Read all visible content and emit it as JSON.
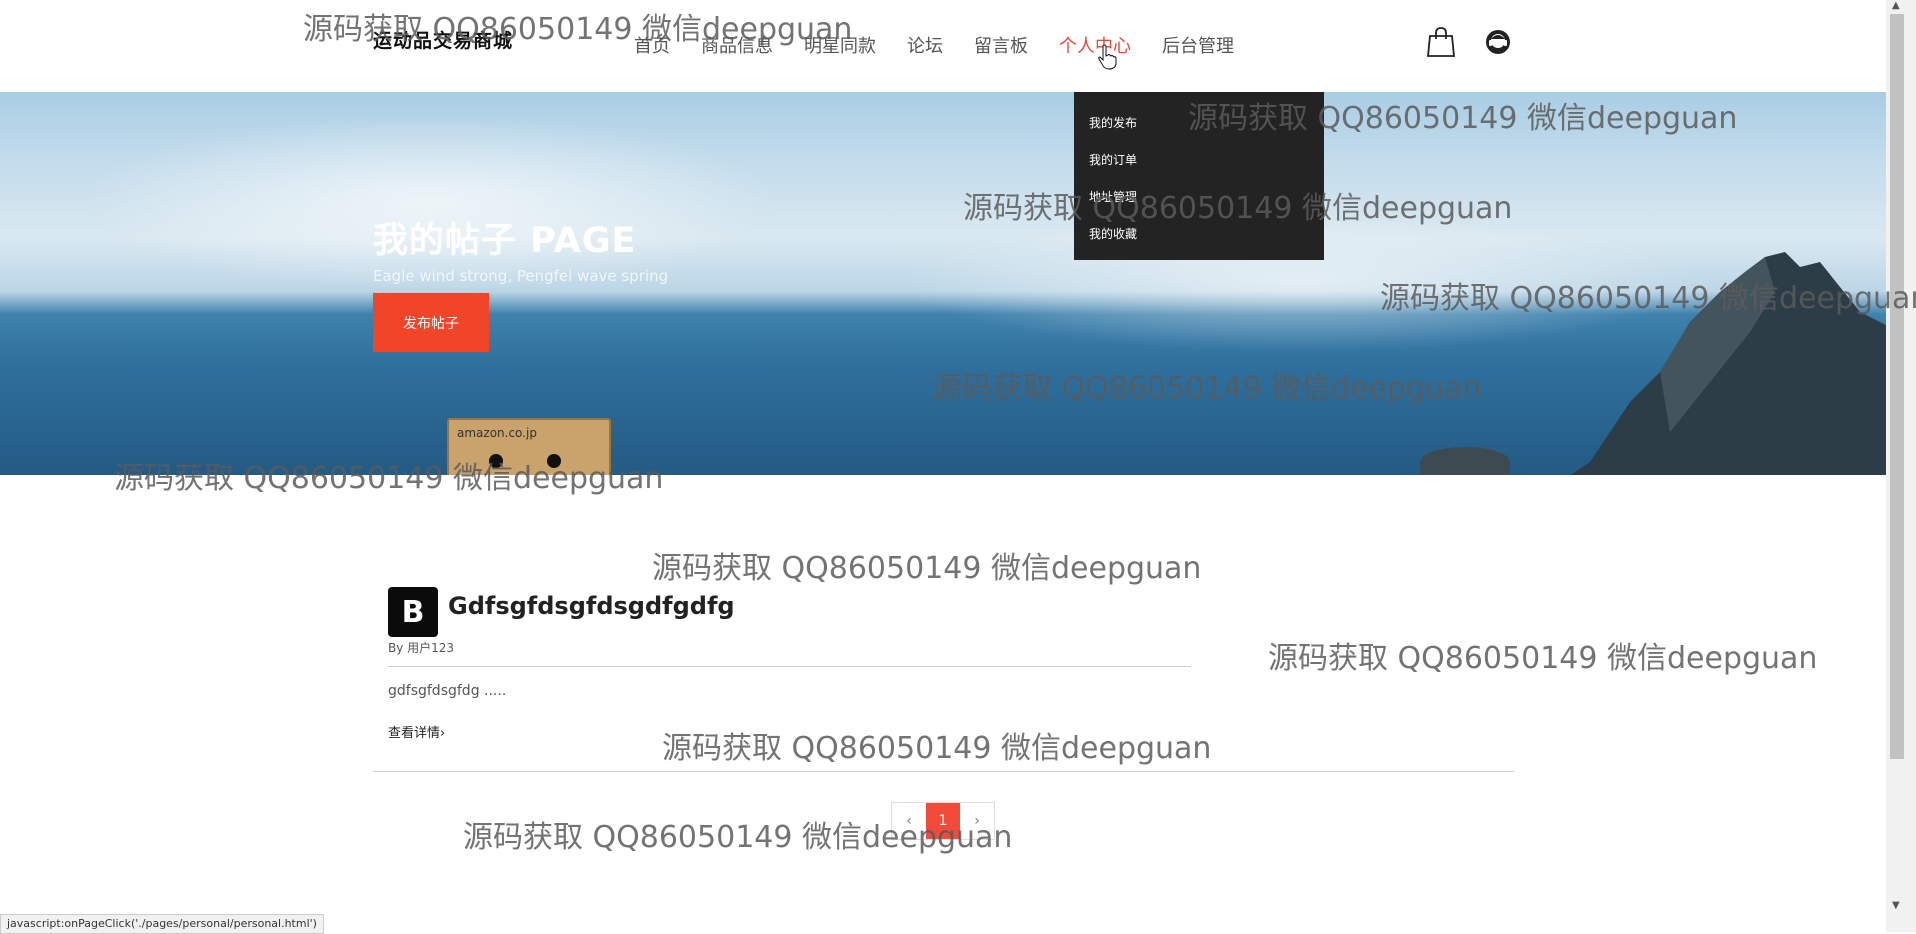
{
  "header": {
    "logo": "运动品交易商城",
    "nav": [
      "首页",
      "商品信息",
      "明星同款",
      "论坛",
      "留言板",
      "个人中心",
      "后台管理"
    ],
    "active_nav": "个人中心"
  },
  "dropdown": {
    "items": [
      "我的发布",
      "我的订单",
      "地址管理",
      "我的收藏"
    ]
  },
  "hero": {
    "title": "我的帖子 PAGE",
    "subtitle": "Eagle wind strong, Pengfei wave spring",
    "button": "发布帖子",
    "box_label": "amazon.co.jp"
  },
  "post": {
    "avatar_letter": "B",
    "title": "Gdfsgfdsgfdsgdfgdfg",
    "author": "By 用户123",
    "excerpt": "gdfsgfdsgfdg .....",
    "more": "查看详情›"
  },
  "pagination": {
    "prev": "‹",
    "current": "1",
    "next": "›"
  },
  "statusbar": "javascript:onPageClick('./pages/personal/personal.html')",
  "watermark": "源码获取 QQ86050149 微信deepguan",
  "colors": {
    "accent": "#e5493a",
    "button": "#f1452a",
    "dropdown_bg": "#232323"
  }
}
